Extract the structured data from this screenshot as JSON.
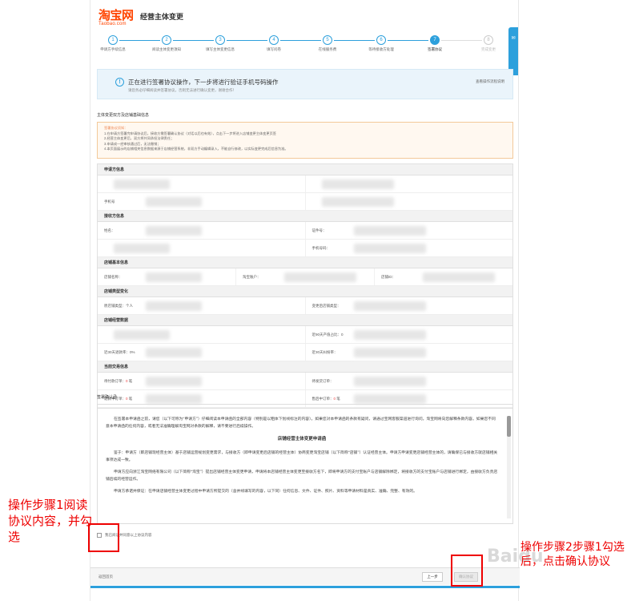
{
  "header": {
    "logo_text": "淘宝网",
    "logo_sub": "Taobao.com",
    "page_title": "经营主体变更"
  },
  "steps": [
    {
      "num": "1",
      "label": "申请方手续信息"
    },
    {
      "num": "2",
      "label": "阅读主体变更须知"
    },
    {
      "num": "3",
      "label": "填写主体变更信息"
    },
    {
      "num": "4",
      "label": "填写问卷"
    },
    {
      "num": "5",
      "label": "在线服务费"
    },
    {
      "num": "6",
      "label": "等待接收方处理"
    },
    {
      "num": "7",
      "label": "签署协议"
    },
    {
      "num": "8",
      "label": "完成变更"
    }
  ],
  "info": {
    "main": "正在进行签署协议操作，下一步将进行验证手机号码操作",
    "sub": "请您务必仔细阅读并签署协议，否则无法进行确认变更，谢谢合作！",
    "link": "查看操作流程说明"
  },
  "section_title": "主体变更双方及店铺基础信息",
  "notice": {
    "title": "签署协议须知：",
    "lines": [
      "1.在申请方签署完申请协议后，接收方需签署确认协议（对话以后也有效），点击下一步将进入店铺变更主体变更页签",
      "2.经营主体变更后，双方将共同承担法律责任；",
      "3.申请成一经审核通过后，无法撤销；",
      "4.本页面展示的店铺相关信息数据来源于店铺经营系统，非双方手动编辑录入，不能自行修改，以实际变更完成后信息为准。"
    ]
  },
  "groups": [
    {
      "title": "申请方信息",
      "rows": [
        [
          "",
          ""
        ],
        [
          "手机号",
          ""
        ]
      ]
    },
    {
      "title": "接收方信息",
      "rows": [
        [
          "姓名：",
          "证件号："
        ],
        [
          "",
          "手机号码："
        ]
      ]
    },
    {
      "title": "店铺基本信息",
      "rows": [
        [
          "店铺名称：",
          "淘宝账户：",
          "店铺ID："
        ]
      ]
    },
    {
      "title": "店铺类型变化",
      "rows": [
        [
          "原店铺类型：个人",
          "变更后店铺类型："
        ]
      ]
    },
    {
      "title": "店铺经营数据",
      "rows": [
        [
          "",
          "近90天产值占比：0"
        ],
        [
          "近30天退款率：0%",
          "近30天纠纷率："
        ]
      ]
    },
    {
      "title": "当前交易信息",
      "rows": [
        [
          "待付款订单：0 笔",
          "待发货订单："
        ],
        [
          "退款中订单：0 笔",
          "售后中订单：0 笔"
        ]
      ]
    }
  ],
  "agreement": {
    "title": "签署确认函",
    "intro": "在签署本申请函之前，请您（以下可称为“申请方”）仔细阅读本申请函的全部内容（特别是以粗体下划线标注的内容）。如果您对本申请函的条款有疑问，请通过宝网客服渠道进行询问，淘宝网将向您解释条款内容。如果您不同意本申请函的任何内容，或者无法准确理解淘宝网对条款的解释，请不要进行后续操作。",
    "heading": "店铺经营主体变更申请函",
    "p1": "鉴于：申请方（即店铺现经营主体）基于店铺运营规划变更需求，与接收方（即申请变更后店铺的经营主体）协商变更淘宝店铺（以下简称“店铺”）认证经营主体。申请方申请变更店铺经营主体的，请确保已与接收方就店铺相关事项达成一致。",
    "p2": "申请方应向浙江淘宝网络有限公司（以下简称“淘宝”）提出店铺经营主体变更申请，申请将本店铺经营主体变更至接收方名下，即将申请方的支付宝账户与店铺解除绑定，将接收方的支付宝账户与店铺进行绑定，由接收方负责店铺后续的经营运作。",
    "p3": "申请方承诺并保证：在申请店铺经营主体变更过程中申请方所提交的（含并线填写的内容，以下同）任何信息、文件、证件、照片、资料等申请材料是真实、准确、完整、有效的。"
  },
  "confirm_checkbox_label": "我已阅读并同意以上协议内容",
  "footer": {
    "left_label": "返回首页",
    "prev_label": "上一步",
    "confirm_label": "确认协议"
  },
  "annotations": {
    "note1": "操作步骤1阅读协议内容，并勾选",
    "note2": "操作步骤2步骤1勾选后，点击确认协议",
    "watermark": "Baidu"
  }
}
